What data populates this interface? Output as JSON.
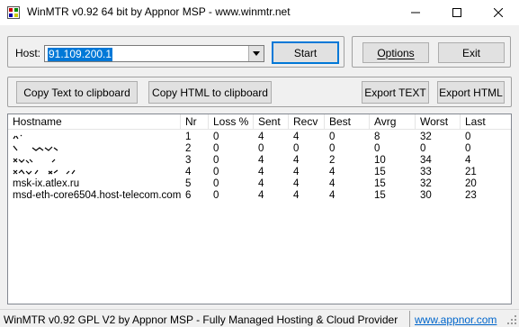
{
  "window": {
    "title": "WinMTR v0.92 64 bit by Appnor MSP - www.winmtr.net",
    "icon": "winmtr-app-icon"
  },
  "host": {
    "label": "Host:",
    "value": "91.109.200.1"
  },
  "buttons": {
    "start": "Start",
    "options": "Options",
    "exit": "Exit",
    "copy_text": "Copy Text to clipboard",
    "copy_html": "Copy HTML to clipboard",
    "export_text": "Export TEXT",
    "export_html": "Export HTML"
  },
  "table": {
    "columns": [
      "Hostname",
      "Nr",
      "Loss %",
      "Sent",
      "Recv",
      "Best",
      "Avrg",
      "Worst",
      "Last"
    ],
    "rows": [
      [
        "",
        "1",
        "0",
        "4",
        "4",
        "0",
        "8",
        "32",
        "0"
      ],
      [
        "",
        "2",
        "0",
        "0",
        "0",
        "0",
        "0",
        "0",
        "0"
      ],
      [
        "",
        "3",
        "0",
        "4",
        "4",
        "2",
        "10",
        "34",
        "4"
      ],
      [
        "",
        "4",
        "0",
        "4",
        "4",
        "4",
        "15",
        "33",
        "21"
      ],
      [
        "msk-ix.atlex.ru",
        "5",
        "0",
        "4",
        "4",
        "4",
        "15",
        "32",
        "20"
      ],
      [
        "msd-eth-core6504.host-telecom.com",
        "6",
        "0",
        "4",
        "4",
        "4",
        "15",
        "30",
        "23"
      ]
    ]
  },
  "status": {
    "text": "WinMTR v0.92 GPL V2 by Appnor MSP - Fully Managed Hosting & Cloud Provider",
    "link": "www.appnor.com"
  },
  "colors": {
    "selection": "#0078d7",
    "link": "#0066cc",
    "face": "#f0f0f0"
  }
}
